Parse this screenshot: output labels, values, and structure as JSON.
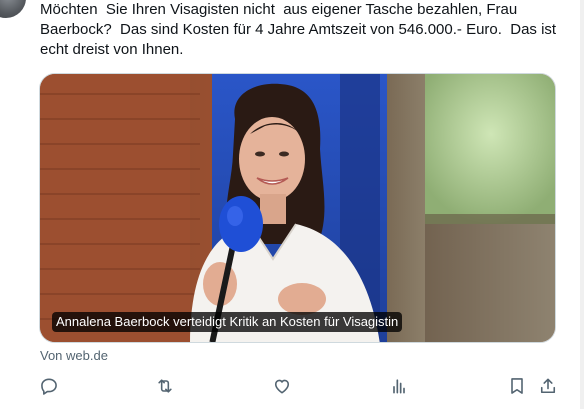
{
  "tweet": {
    "text": "Möchten  Sie Ihren Visagisten nicht  aus eigener Tasche bezahlen, Frau Baerbock?  Das sind Kosten für 4 Jahre Amtszeit von 546.000.- Euro.  Das ist echt dreist von Ihnen."
  },
  "card": {
    "caption": "Annalena Baerbock verteidigt Kritik an Kosten für Visagistin",
    "source": "Von web.de"
  },
  "actions": {
    "icons": [
      "reply-icon",
      "retweet-icon",
      "like-icon",
      "views-icon",
      "bookmark-icon",
      "share-icon"
    ]
  },
  "colors": {
    "text": "#0f1419",
    "secondary": "#536471",
    "border": "#cfd9de",
    "microphone": "#1f4fd6"
  }
}
